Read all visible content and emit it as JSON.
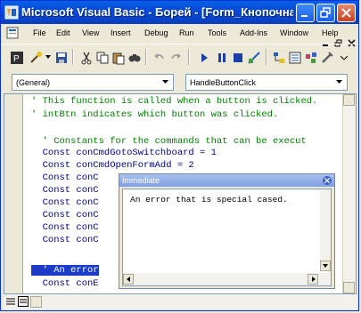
{
  "titlebar": {
    "title": "Microsoft Visual Basic - Борей - [Form_Кнопочная форм...",
    "colors": {
      "caption": "#0a5fe6",
      "close": "#c7401f"
    }
  },
  "menubar": {
    "items": [
      "File",
      "Edit",
      "View",
      "Insert",
      "Debug",
      "Run",
      "Tools",
      "Add-Ins",
      "Window",
      "Help"
    ]
  },
  "combos": {
    "object": "(General)",
    "procedure": "HandleButtonClick"
  },
  "code": {
    "lines": [
      {
        "text": "' This function is called when a button is clicked.",
        "style": "comment"
      },
      {
        "text": "' intBtn indicates which button was clicked.",
        "style": "comment"
      },
      {
        "text": "",
        "style": "plain"
      },
      {
        "text": "  ' Constants for the commands that can be execut",
        "style": "comment"
      },
      {
        "text": "  Const conCmdGotoSwitchboard = 1",
        "style": "plain"
      },
      {
        "text": "  Const conCmdOpenFormAdd = 2",
        "style": "plain"
      },
      {
        "text": "  Const conC",
        "style": "plain"
      },
      {
        "text": "  Const conC",
        "style": "plain"
      },
      {
        "text": "  Const conC",
        "style": "plain"
      },
      {
        "text": "  Const conC",
        "style": "plain"
      },
      {
        "text": "  Const conC",
        "style": "plain"
      },
      {
        "text": "  Const conC",
        "style": "plain"
      },
      {
        "text": "",
        "style": "plain"
      },
      {
        "text": "  ' An error",
        "style": "selected"
      },
      {
        "text": "  Const conE",
        "style": "plain"
      }
    ],
    "selection_color": "#1a3cc8"
  },
  "immediate": {
    "title": "Immediate",
    "output": "An error that is special cased."
  }
}
